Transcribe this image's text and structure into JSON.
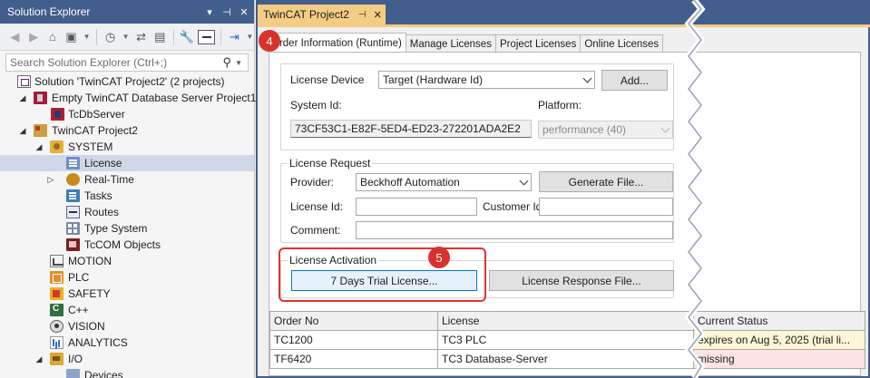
{
  "solution_explorer": {
    "title": "Solution Explorer",
    "search_placeholder": "Search Solution Explorer (Ctrl+;)",
    "tree": [
      {
        "label": "Solution 'TwinCAT Project2' (2 projects)",
        "icon": "solution-icon"
      },
      {
        "label": "Empty TwinCAT Database Server Project1",
        "icon": "database-project-icon"
      },
      {
        "label": "TcDbServer",
        "icon": "database-server-icon"
      },
      {
        "label": "TwinCAT Project2",
        "icon": "twincat-project-icon"
      },
      {
        "label": "SYSTEM",
        "icon": "system-icon"
      },
      {
        "label": "License",
        "icon": "license-icon"
      },
      {
        "label": "Real-Time",
        "icon": "realtime-icon"
      },
      {
        "label": "Tasks",
        "icon": "tasks-icon"
      },
      {
        "label": "Routes",
        "icon": "routes-icon"
      },
      {
        "label": "Type System",
        "icon": "type-system-icon"
      },
      {
        "label": "TcCOM Objects",
        "icon": "tccom-objects-icon"
      },
      {
        "label": "MOTION",
        "icon": "motion-icon"
      },
      {
        "label": "PLC",
        "icon": "plc-icon"
      },
      {
        "label": "SAFETY",
        "icon": "safety-icon"
      },
      {
        "label": "C++",
        "icon": "cpp-icon"
      },
      {
        "label": "VISION",
        "icon": "vision-icon"
      },
      {
        "label": "ANALYTICS",
        "icon": "analytics-icon"
      },
      {
        "label": "I/O",
        "icon": "io-icon"
      },
      {
        "label": "Devices",
        "icon": "devices-icon"
      }
    ]
  },
  "document": {
    "tab_title": "TwinCAT Project2",
    "subtabs": [
      "Order Information (Runtime)",
      "Manage Licenses",
      "Project Licenses",
      "Online Licenses"
    ],
    "license_device": {
      "label": "License Device",
      "value": "Target (Hardware Id)",
      "add_button": "Add...",
      "system_id_label": "System Id:",
      "system_id_value": "73CF53C1-E82F-5ED4-ED23-272201ADA2E2",
      "platform_label": "Platform:",
      "platform_value": "performance (40)"
    },
    "license_request": {
      "title": "License Request",
      "provider_label": "Provider:",
      "provider_value": "Beckhoff Automation",
      "generate_button": "Generate File...",
      "license_id_label": "License Id:",
      "customer_id_label": "Customer Id:",
      "comment_label": "Comment:"
    },
    "license_activation": {
      "title": "License Activation",
      "trial_button": "7 Days Trial License...",
      "response_button": "License Response File..."
    },
    "table": {
      "headers": [
        "Order No",
        "License",
        "Current Status"
      ],
      "rows": [
        {
          "order": "TC1200",
          "license": "TC3 PLC",
          "status": "expires on Aug 5, 2025 (trial li..."
        },
        {
          "order": "TF6420",
          "license": "TC3 Database-Server",
          "status": "missing"
        }
      ]
    },
    "callouts": {
      "step4": "4",
      "step5": "5"
    }
  },
  "colors": {
    "title_bar": "#425e8c",
    "active_tab": "#f5cc84",
    "selection": "#cfd8e6",
    "callout": "#e3312d",
    "status_warn": "#fdf5d6",
    "status_missing": "#fde3e3"
  }
}
